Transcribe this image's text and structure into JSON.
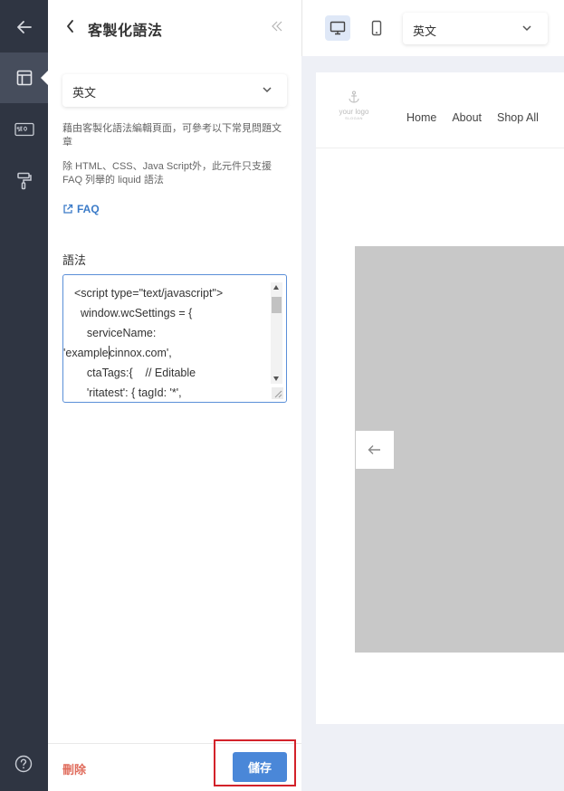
{
  "panel": {
    "title": "客製化語法",
    "language_select": {
      "value": "英文"
    },
    "description_1": "藉由客製化語法編輯頁面，可參考以下常見問題文章",
    "description_2": "除 HTML、CSS、Java Script外，此元件只支援 FAQ 列舉的 liquid 語法",
    "faq_link": "FAQ",
    "syntax_label": "語法",
    "code_lines": [
      "<script type=\"text/javascript\">",
      "  window.wcSettings = {",
      "    serviceName:",
      "'example",
      "    ctaTags:{    // Editable",
      "    'ritatest': { tagId: '*',"
    ],
    "code_line4_after_caret": "cinnox.com',",
    "delete_label": "刪除",
    "save_label": "儲存"
  },
  "preview": {
    "language_select": {
      "value": "英文"
    },
    "site_logo": {
      "text": "your logo",
      "subtext": "SLOGAN"
    },
    "nav_links": [
      "Home",
      "About",
      "Shop All"
    ]
  },
  "colors": {
    "rail": "#2f3542",
    "primary": "#4a87d8",
    "danger_text": "#e06c5c",
    "highlight": "#d3222a"
  }
}
